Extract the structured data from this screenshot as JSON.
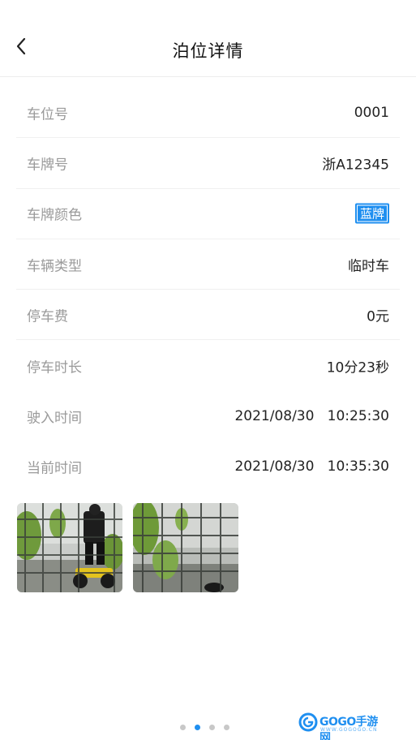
{
  "header": {
    "title": "泊位详情"
  },
  "details": [
    {
      "label": "车位号",
      "value": "0001"
    },
    {
      "label": "车牌号",
      "value": "浙A12345"
    },
    {
      "label": "车牌颜色",
      "value": "蓝牌"
    },
    {
      "label": "车辆类型",
      "value": "临时车"
    },
    {
      "label": "停车费",
      "value": "0元"
    },
    {
      "label": "停车时长",
      "value": "10分23秒"
    },
    {
      "label": "驶入时间",
      "value": "2021/08/30   10:25:30"
    },
    {
      "label": "当前时间",
      "value": "2021/08/30   10:35:30"
    }
  ],
  "pagination": {
    "pages": 4,
    "active": 2
  },
  "watermark": {
    "text": "GOGO手游网",
    "sub": "WWW.GOGOGO.CN"
  },
  "colors": {
    "accent": "#1f8ff0",
    "label": "#9a9a9a",
    "plate_blue": "#1f8ff0"
  }
}
